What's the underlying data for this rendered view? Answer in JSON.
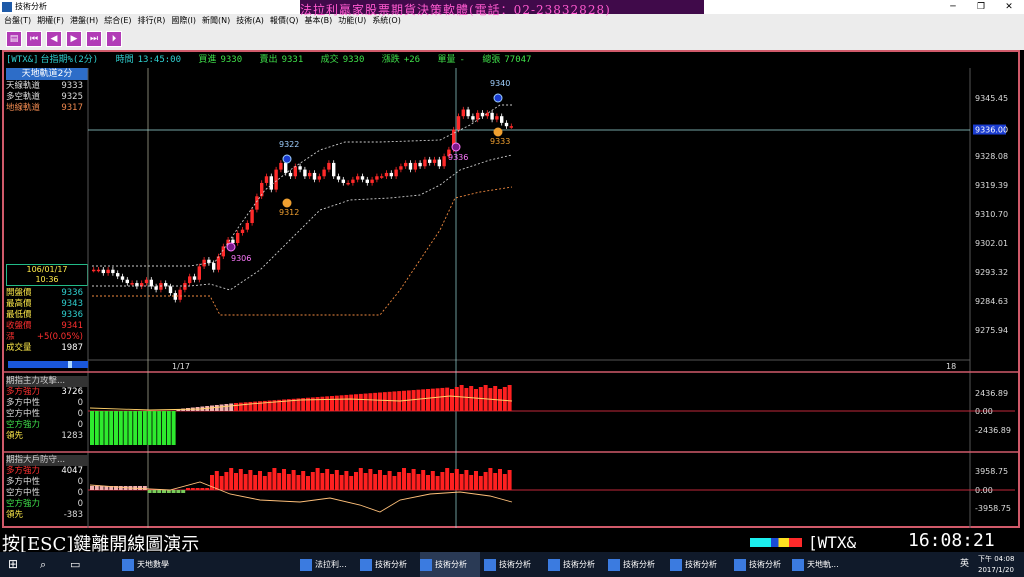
{
  "window": {
    "title": "技術分析"
  },
  "menu": [
    "台盤(T)",
    "期權(F)",
    "港盤(H)",
    "綜合(E)",
    "排行(R)",
    "國際(I)",
    "新聞(N)",
    "技術(A)",
    "報價(Q)",
    "基本(B)",
    "功能(U)",
    "系統(O)"
  ],
  "banner": "法拉利贏家股票期貨決策軟體(電話：02-23832828)",
  "infobar": {
    "symbol": "[WTX&]",
    "name": "台指期%(2分)",
    "time_label": "時間",
    "time": "13:45:00",
    "bid_label": "買進",
    "bid": "9330",
    "ask_label": "賣出",
    "ask": "9331",
    "deal_label": "成交",
    "deal": "9330",
    "change_label": "漲跌",
    "change": "+26",
    "vol_label": "單量",
    "vol": "-",
    "total_label": "總張",
    "total": "77047"
  },
  "left_panel": {
    "title": "天地軌道2分",
    "rows": [
      {
        "label": "天線軌道",
        "value": "9333"
      },
      {
        "label": "多空軌道",
        "value": "9325"
      },
      {
        "label": "地線軌道",
        "value": "9317"
      }
    ],
    "date": "106/01/17",
    "time": "10:36",
    "quotes": [
      {
        "label": "開盤價",
        "value": "9336"
      },
      {
        "label": "最高價",
        "value": "9343"
      },
      {
        "label": "最低價",
        "value": "9336"
      },
      {
        "label": "收盤價",
        "value": "9341"
      },
      {
        "label": "漲",
        "value": "+5(0.05%)"
      },
      {
        "label": "成交量",
        "value": "1987"
      }
    ]
  },
  "price_axis": [
    "9345.45",
    "9336.00",
    "9328.08",
    "9319.39",
    "9310.70",
    "9302.01",
    "9293.32",
    "9284.63",
    "9275.94"
  ],
  "x_labels": [
    "1/17",
    "18"
  ],
  "annotations": [
    "9340",
    "9322",
    "9336",
    "9333",
    "9312",
    "9306"
  ],
  "panel2": {
    "title": "期指主力攻擊...",
    "rows": [
      {
        "label": "多方強力",
        "value": "3726"
      },
      {
        "label": "多方中性",
        "value": "0"
      },
      {
        "label": "空方中性",
        "value": "0"
      },
      {
        "label": "空方強力",
        "value": "0"
      },
      {
        "label": "領先",
        "value": "1283"
      }
    ],
    "axis": [
      "2436.89",
      "0.00",
      "-2436.89"
    ]
  },
  "panel3": {
    "title": "期指大戶防守...",
    "rows": [
      {
        "label": "多方強力",
        "value": "4047"
      },
      {
        "label": "多方中性",
        "value": "0"
      },
      {
        "label": "空方中性",
        "value": "0"
      },
      {
        "label": "空方強力",
        "value": "0"
      },
      {
        "label": "領先",
        "value": "-383"
      }
    ],
    "axis": [
      "3958.75",
      "0.00",
      "-3958.75"
    ]
  },
  "bottom": {
    "press": "按[ESC]鍵離開線圖演示",
    "symbol": "[WTX&",
    "clock": "16:08:21"
  },
  "taskbar": {
    "items": [
      "天地數學",
      "法拉利...",
      "技術分析",
      "技術分析",
      "技術分析",
      "技術分析",
      "技術分析",
      "技術分析",
      "技術分析",
      "天地軌..."
    ],
    "time": "下午 04:08",
    "date": "2017/1/20",
    "ime": "英"
  }
}
